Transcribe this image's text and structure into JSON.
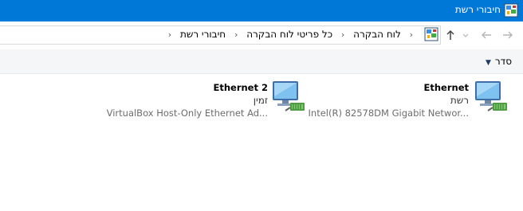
{
  "window": {
    "title": "חיבורי רשת"
  },
  "address": {
    "breadcrumbs": [
      "לוח הבקרה",
      "כל פריטי לוח הבקרה",
      "חיבורי רשת"
    ]
  },
  "toolbar": {
    "organize_label": "סדר"
  },
  "connections": [
    {
      "name": "Ethernet",
      "status": "רשת",
      "device": "Intel(R) 82578DM Gigabit Networ..."
    },
    {
      "name": "Ethernet 2",
      "status": "זמין",
      "device": "VirtualBox Host-Only Ethernet Ad..."
    }
  ],
  "colors": {
    "titlebar": "#0078d7",
    "commandbar": "#f5f6f7"
  }
}
